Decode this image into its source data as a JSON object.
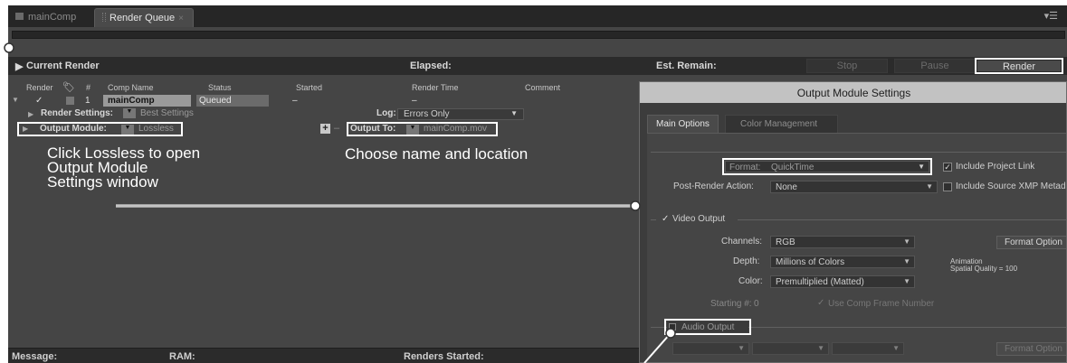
{
  "tabs": {
    "main_comp": "mainComp",
    "render_queue": "Render Queue",
    "close_glyph": "×",
    "panel_menu_glyph": "▾☰"
  },
  "current_render": {
    "title": "Current Render",
    "elapsed_label": "Elapsed:",
    "est_remain_label": "Est. Remain:",
    "stop_label": "Stop",
    "pause_label": "Pause",
    "render_label": "Render"
  },
  "columns": {
    "render": "Render",
    "num": "#",
    "comp_name": "Comp Name",
    "status": "Status",
    "started": "Started",
    "render_time": "Render Time",
    "comment": "Comment"
  },
  "queue_item": {
    "number": "1",
    "comp_name": "mainComp",
    "status": "Queued",
    "started": "–",
    "render_time": "–",
    "checked_glyph": "✓"
  },
  "render_settings": {
    "label": "Render Settings:",
    "value": "Best Settings",
    "log_label": "Log:",
    "log_value": "Errors Only"
  },
  "output_module": {
    "label": "Output Module:",
    "value": "Lossless",
    "output_to_label": "Output To:",
    "output_to_value": "mainComp.mov",
    "plus": "+",
    "minus": "–"
  },
  "annotations": {
    "lossless_note": "Click Lossless to open Output Module Settings window",
    "output_note": "Choose name and location"
  },
  "status_bar": {
    "message_label": "Message:",
    "ram_label": "RAM:",
    "renders_started_label": "Renders Started:"
  },
  "dialog": {
    "title": "Output Module Settings",
    "tab_main": "Main Options",
    "tab_color": "Color Management",
    "format_label": "Format:",
    "format_value": "QuickTime",
    "include_project_link": "Include Project Link",
    "post_render_label": "Post-Render Action:",
    "post_render_value": "None",
    "include_xmp": "Include Source XMP Metad",
    "video_output": "Video Output",
    "channels_label": "Channels:",
    "channels_value": "RGB",
    "depth_label": "Depth:",
    "depth_value": "Millions of Colors",
    "color_label": "Color:",
    "color_value": "Premultiplied (Matted)",
    "starting_label": "Starting #:",
    "starting_value": "0",
    "use_comp_frame": "Use Comp Frame Number",
    "format_options": "Format Option",
    "codec_info_1": "Animation",
    "codec_info_2": "Spatial Quality = 100",
    "audio_output": "Audio Output",
    "audio_format_options": "Format Option"
  },
  "colors": {
    "panel_bg": "#454545",
    "highlight_outline": "#ffffff",
    "dialog_title_bg": "#c2c2c2"
  }
}
